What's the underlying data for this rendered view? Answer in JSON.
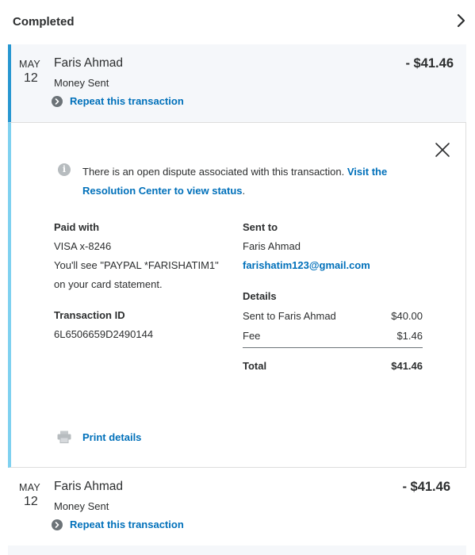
{
  "section": {
    "title": "Completed"
  },
  "transactions": [
    {
      "month": "MAY",
      "day": "12",
      "name": "Faris Ahmad",
      "type": "Money Sent",
      "amount": "- $41.46",
      "repeat_label": "Repeat this transaction"
    },
    {
      "month": "MAY",
      "day": "12",
      "name": "Faris Ahmad",
      "type": "Money Sent",
      "amount": "- $41.46",
      "repeat_label": "Repeat this transaction"
    }
  ],
  "details": {
    "dispute_text": "There is an open dispute associated with this transaction.",
    "dispute_link": "Visit the Resolution Center to view status",
    "dispute_end": ".",
    "paid_with_label": "Paid with",
    "card": "VISA x-8246",
    "statement_line1": "You'll see \"PAYPAL *FARISHATIM1\"",
    "statement_line2": "on your card statement.",
    "transaction_id_label": "Transaction ID",
    "transaction_id": "6L6506659D2490144",
    "sent_to_label": "Sent to",
    "recipient_name": "Faris Ahmad",
    "recipient_email": "farishatim123@gmail.com",
    "details_label": "Details",
    "line_items": [
      {
        "label": "Sent to Faris Ahmad",
        "value": "$40.00"
      },
      {
        "label": "Fee",
        "value": "$1.46"
      }
    ],
    "total_label": "Total",
    "total_value": "$41.46",
    "print_label": "Print details"
  },
  "icons": {
    "header_chevron": "chevron-right-icon",
    "repeat": "chevron-circle-right-icon",
    "close": "close-icon",
    "info": "info-icon",
    "print": "printer-icon"
  },
  "colors": {
    "link": "#0070ba",
    "accent_bar": "#2797d1",
    "panel_bar": "#7fd1f0",
    "row_bg": "#f5f7fa"
  }
}
